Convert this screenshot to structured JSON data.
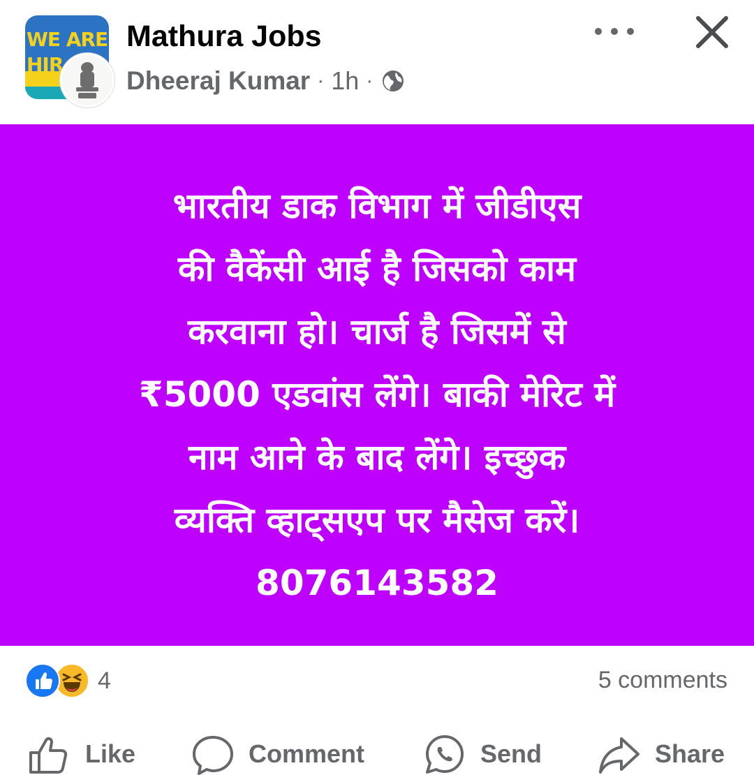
{
  "header": {
    "group_name": "Mathura Jobs",
    "author": "Dheeraj Kumar",
    "separator": "·",
    "time": "1h",
    "privacy_icon": "globe-icon",
    "group_logo_line1": "WE ARE",
    "group_logo_line2": "HIR"
  },
  "post": {
    "background_color": "#bd00ff",
    "text": "भारतीय डाक विभाग में जीडीएस\nकी वैकेंसी आई है जिसको काम\nकरवाना हो। चार्ज  है जिसमें से\n₹5000 एडवांस लेंगे। बाकी मेरिट में\nनाम आने के बाद लेंगे। इच्छुक\nव्यक्ति व्हाट्सएप पर मैसेज करें।\n8076143582"
  },
  "stats": {
    "reaction_count": "4",
    "comments": "5 comments",
    "reaction_icons": [
      "like-icon",
      "haha-icon"
    ]
  },
  "actions": {
    "like": "Like",
    "comment": "Comment",
    "send": "Send",
    "share": "Share"
  },
  "colors": {
    "text_primary": "#050505",
    "text_secondary": "#65676b",
    "like_blue": "#1877f2",
    "haha_yellow": "#f7b928"
  }
}
